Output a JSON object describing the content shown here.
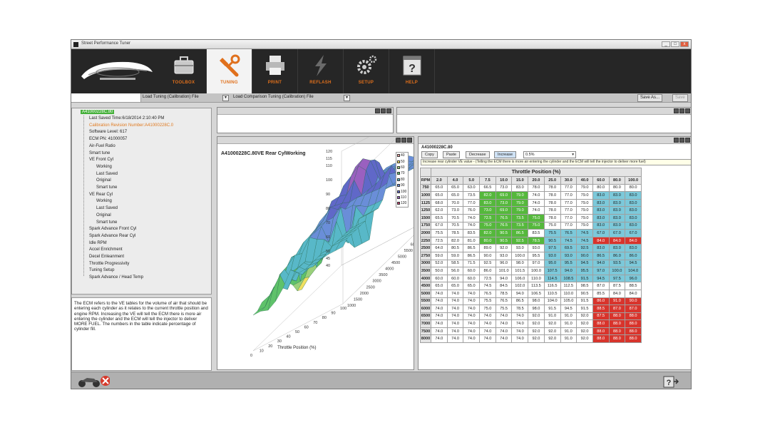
{
  "window": {
    "title": "Street Performance Tuner"
  },
  "toolbar": {
    "items": [
      {
        "label": "TOOLBOX",
        "icon": "toolbox-icon"
      },
      {
        "label": "TUNING",
        "icon": "wrench-icon"
      },
      {
        "label": "PRINT",
        "icon": "printer-icon"
      },
      {
        "label": "REFLASH",
        "icon": "lightning-icon"
      },
      {
        "label": "SETUP",
        "icon": "gears-icon"
      },
      {
        "label": "HELP",
        "icon": "help-icon"
      }
    ]
  },
  "menubar": {
    "load_tuning": "Load Tuning (Calibration) File",
    "load_comparison": "Load Comparison Tuning (Calibration) File",
    "save_as": "Save As...",
    "save": "Save"
  },
  "tree": {
    "root": "A41000228C.80",
    "items": [
      {
        "text": "Last Saved Time:6/18/2014 2:10:40 PM",
        "level": 1,
        "color": "normal"
      },
      {
        "text": "Calibration Revision Number:A41000228C.0",
        "level": 1,
        "color": "orange"
      },
      {
        "text": "Software Level: 617",
        "level": 1,
        "color": "normal"
      },
      {
        "text": "ECM PN: 41000057",
        "level": 1,
        "color": "normal"
      },
      {
        "text": "Air-Fuel Ratio",
        "level": 1,
        "color": "normal"
      },
      {
        "text": "Smart tune",
        "level": 1,
        "color": "normal"
      },
      {
        "text": "VE Front Cyl",
        "level": 1,
        "color": "normal"
      },
      {
        "text": "Working",
        "level": 2,
        "color": "normal"
      },
      {
        "text": "Last Saved",
        "level": 2,
        "color": "normal"
      },
      {
        "text": "Original",
        "level": 2,
        "color": "normal"
      },
      {
        "text": "Smart tune",
        "level": 2,
        "color": "normal"
      },
      {
        "text": "VE Rear Cyl",
        "level": 1,
        "color": "normal"
      },
      {
        "text": "Working",
        "level": 2,
        "color": "normal"
      },
      {
        "text": "Last Saved",
        "level": 2,
        "color": "normal"
      },
      {
        "text": "Original",
        "level": 2,
        "color": "normal"
      },
      {
        "text": "Smart tune",
        "level": 2,
        "color": "normal"
      },
      {
        "text": "Spark Advance Front Cyl",
        "level": 1,
        "color": "normal"
      },
      {
        "text": "Spark Advance Rear Cyl",
        "level": 1,
        "color": "normal"
      },
      {
        "text": "Idle RPM",
        "level": 1,
        "color": "normal"
      },
      {
        "text": "Accel Enrichment",
        "level": 1,
        "color": "normal"
      },
      {
        "text": "Decel Enleanment",
        "level": 1,
        "color": "normal"
      },
      {
        "text": "Throttle Progressivity",
        "level": 1,
        "color": "normal"
      },
      {
        "text": "Tuning Setup",
        "level": 1,
        "color": "normal"
      },
      {
        "text": "Spark Advance / Head Temp",
        "level": 1,
        "color": "normal"
      }
    ]
  },
  "description": "The ECM refers to the VE tables for the volume of air that should be entering each cylinder as it relates to the current throttle position and engine RPM.  Increasing the VE will tell the ECM there is more air entering the cylinder and the ECM will tell the injector to deliver MORE FUEL.  The numbers in the table indicate percentage of cylinder fill.",
  "chart": {
    "title": "A41000228C.80VE Rear CylWorking",
    "z_ticks": [
      "120",
      "115",
      "110",
      "100",
      "90",
      "80",
      "70",
      "60",
      "50",
      "45",
      "40"
    ],
    "x_label": "Throttle Position (%)",
    "x_ticks": [
      "100",
      "90",
      "80",
      "70",
      "60",
      "50",
      "40",
      "30",
      "20",
      "10",
      "0"
    ],
    "y_label": "RPM",
    "y_ticks": [
      "8000",
      "7500",
      "7000",
      "6500",
      "6000",
      "5500",
      "5000",
      "4500",
      "4000",
      "3500",
      "3000",
      "2500",
      "2000",
      "1500",
      "1000"
    ],
    "legend": [
      {
        "label": "40",
        "color": "#e8a0a0"
      },
      {
        "label": "50",
        "color": "#f0e060"
      },
      {
        "label": "60",
        "color": "#9ad07a"
      },
      {
        "label": "70",
        "color": "#5fc26a"
      },
      {
        "label": "80",
        "color": "#58b8c8"
      },
      {
        "label": "90",
        "color": "#6a8ed8"
      },
      {
        "label": "100",
        "color": "#6068c8"
      },
      {
        "label": "110",
        "color": "#9a60c0"
      },
      {
        "label": "120",
        "color": "#c04070"
      }
    ]
  },
  "ve_panel": {
    "title": "A41000228C.80",
    "buttons": [
      "Copy",
      "Paste",
      "Decrease",
      "Increase"
    ],
    "increment": "0.5%",
    "tooltip": "Increase rear cylinder VE value - (Telling the ECM there is more air entering the cylinder and the ECM will tell the injector to deliver more fuel)"
  },
  "ve_table": {
    "header": "Throttle Position (%)",
    "corner": "RPM",
    "columns": [
      "2.0",
      "4.0",
      "5.0",
      "7.5",
      "10.0",
      "15.0",
      "20.0",
      "25.0",
      "30.0",
      "40.0",
      "60.0",
      "80.0",
      "100.0"
    ],
    "rows": [
      {
        "rpm": "750",
        "values": [
          "65.0",
          "65.0",
          "63.0",
          "66.5",
          "73.0",
          "83.0",
          "78.0",
          "78.0",
          "77.0",
          "79.0",
          "80.0",
          "80.0",
          "80.0"
        ],
        "colors": "nnnnnnnnnnnnn"
      },
      {
        "rpm": "1000",
        "values": [
          "65.0",
          "65.0",
          "73.5",
          "82.0",
          "69.0",
          "79.0",
          "74.0",
          "78.0",
          "77.0",
          "79.0",
          "83.0",
          "83.0",
          "83.0"
        ],
        "colors": "nnngggnnnnbbb"
      },
      {
        "rpm": "1125",
        "values": [
          "68.0",
          "70.0",
          "77.0",
          "83.0",
          "73.0",
          "79.0",
          "74.0",
          "78.0",
          "77.0",
          "79.0",
          "83.0",
          "83.0",
          "83.0"
        ],
        "colors": "nnngggnnnnbbb"
      },
      {
        "rpm": "1250",
        "values": [
          "62.0",
          "73.0",
          "76.0",
          "73.0",
          "69.0",
          "79.0",
          "74.0",
          "78.0",
          "77.0",
          "79.0",
          "83.0",
          "83.0",
          "83.0"
        ],
        "colors": "nnngggnnnnbbb"
      },
      {
        "rpm": "1500",
        "values": [
          "65.5",
          "70.5",
          "74.0",
          "72.5",
          "76.5",
          "73.5",
          "75.0",
          "78.0",
          "77.0",
          "79.0",
          "83.0",
          "83.0",
          "83.0"
        ],
        "colors": "nnnggggnnnbbb"
      },
      {
        "rpm": "1750",
        "values": [
          "67.0",
          "70.5",
          "74.0",
          "75.0",
          "76.5",
          "73.5",
          "75.0",
          "75.0",
          "77.0",
          "79.0",
          "83.0",
          "83.0",
          "83.0"
        ],
        "colors": "nnnggggnnnbbb"
      },
      {
        "rpm": "2000",
        "values": [
          "75.5",
          "78.5",
          "83.5",
          "82.0",
          "90.5",
          "86.5",
          "83.5",
          "75.5",
          "76.5",
          "74.5",
          "67.0",
          "67.0",
          "67.0"
        ],
        "colors": "nnngggnbbbbbb"
      },
      {
        "rpm": "2250",
        "values": [
          "72.5",
          "82.0",
          "81.0",
          "80.0",
          "90.5",
          "92.5",
          "78.5",
          "90.5",
          "74.5",
          "74.5",
          "84.0",
          "84.0",
          "84.0"
        ],
        "colors": "nnnggggbbbrrr"
      },
      {
        "rpm": "2500",
        "values": [
          "64.0",
          "80.5",
          "86.5",
          "89.0",
          "92.0",
          "93.0",
          "93.0",
          "97.5",
          "69.5",
          "92.5",
          "83.0",
          "83.0",
          "83.0"
        ],
        "colors": "nnnnnnnbbbbbb"
      },
      {
        "rpm": "2750",
        "values": [
          "59.0",
          "59.0",
          "86.5",
          "90.0",
          "93.0",
          "100.0",
          "95.5",
          "93.0",
          "93.0",
          "90.0",
          "86.5",
          "86.0",
          "86.0"
        ],
        "colors": "nnnnnnnbbbbbb"
      },
      {
        "rpm": "3000",
        "values": [
          "52.0",
          "58.5",
          "71.5",
          "92.5",
          "96.0",
          "98.0",
          "97.0",
          "95.0",
          "95.5",
          "94.5",
          "94.0",
          "93.5",
          "94.5"
        ],
        "colors": "nnnnnnnbbbbbb"
      },
      {
        "rpm": "3500",
        "values": [
          "50.0",
          "56.0",
          "60.0",
          "86.0",
          "101.0",
          "101.5",
          "100.0",
          "107.5",
          "94.0",
          "95.5",
          "97.0",
          "100.0",
          "104.0"
        ],
        "colors": "nnnnnnnbbbbbb"
      },
      {
        "rpm": "4000",
        "values": [
          "60.0",
          "60.0",
          "60.0",
          "72.5",
          "94.0",
          "106.0",
          "110.0",
          "114.5",
          "108.5",
          "91.5",
          "94.5",
          "97.5",
          "96.0"
        ],
        "colors": "nnnnnnnbbbbbb"
      },
      {
        "rpm": "4500",
        "values": [
          "65.0",
          "65.0",
          "65.0",
          "74.5",
          "84.5",
          "102.0",
          "113.5",
          "116.5",
          "112.5",
          "98.5",
          "87.0",
          "87.5",
          "88.5"
        ],
        "colors": "nnnnnnnnnnnnn"
      },
      {
        "rpm": "5000",
        "values": [
          "74.0",
          "74.0",
          "74.0",
          "76.5",
          "78.5",
          "94.0",
          "106.5",
          "110.5",
          "110.0",
          "90.5",
          "85.5",
          "84.0",
          "84.0"
        ],
        "colors": "nnnnnnnnnnnnn"
      },
      {
        "rpm": "5500",
        "values": [
          "74.0",
          "74.0",
          "74.0",
          "75.5",
          "76.5",
          "86.5",
          "98.0",
          "104.0",
          "105.0",
          "91.5",
          "86.0",
          "91.0",
          "90.0"
        ],
        "colors": "nnnnnnnnnnrrr"
      },
      {
        "rpm": "6000",
        "values": [
          "74.0",
          "74.0",
          "74.0",
          "75.0",
          "75.5",
          "78.5",
          "98.0",
          "91.5",
          "94.5",
          "91.5",
          "88.5",
          "87.0",
          "87.0"
        ],
        "colors": "nnnnnnnnnnrrr"
      },
      {
        "rpm": "6500",
        "values": [
          "74.0",
          "74.0",
          "74.0",
          "74.0",
          "74.0",
          "74.0",
          "92.0",
          "91.0",
          "91.0",
          "92.0",
          "87.5",
          "88.0",
          "88.0"
        ],
        "colors": "nnnnnnnnnnrrr"
      },
      {
        "rpm": "7000",
        "values": [
          "74.0",
          "74.0",
          "74.0",
          "74.0",
          "74.0",
          "74.0",
          "92.0",
          "92.0",
          "91.0",
          "92.0",
          "88.0",
          "88.0",
          "88.0"
        ],
        "colors": "nnnnnnnnnnrrr"
      },
      {
        "rpm": "7500",
        "values": [
          "74.0",
          "74.0",
          "74.0",
          "74.0",
          "74.0",
          "74.0",
          "92.0",
          "92.0",
          "91.0",
          "92.0",
          "88.0",
          "88.0",
          "88.0"
        ],
        "colors": "nnnnnnnnnnrrr"
      },
      {
        "rpm": "8000",
        "values": [
          "74.0",
          "74.0",
          "74.0",
          "74.0",
          "74.0",
          "74.0",
          "92.0",
          "92.0",
          "91.0",
          "92.0",
          "88.0",
          "88.0",
          "88.0"
        ],
        "colors": "nnnnnnnnnnrrr"
      }
    ]
  },
  "colors": {
    "green": "#55b83c",
    "blue": "#7cc9da",
    "red": "#d8342c",
    "accent": "#e0701c"
  }
}
